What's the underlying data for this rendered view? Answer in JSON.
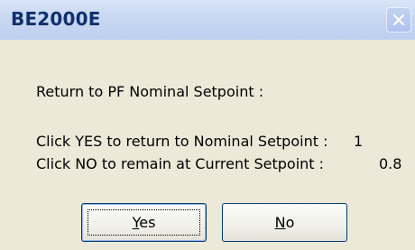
{
  "window": {
    "title": "BE2000E",
    "close_icon": "close-icon"
  },
  "message": {
    "heading": "Return to PF Nominal Setpoint :",
    "line1_text": "Click YES to return to Nominal Setpoint :",
    "line1_value": "1",
    "line2_text": "Click NO to remain at Current Setpoint :",
    "line2_value": "0.8"
  },
  "buttons": {
    "yes": {
      "accel": "Y",
      "rest": "es"
    },
    "no": {
      "accel": "N",
      "rest": "o"
    }
  }
}
